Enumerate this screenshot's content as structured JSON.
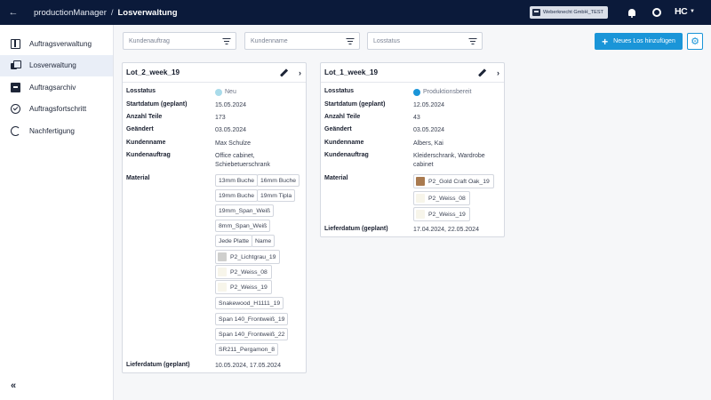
{
  "header": {
    "app_name": "productionManager",
    "separator": "/",
    "page_title": "Losverwaltung",
    "company": "Weberknecht GmbH_TEST",
    "logo": "HC"
  },
  "sidebar": {
    "items": [
      {
        "label": "Auftragsverwaltung",
        "icon": "book-icon"
      },
      {
        "label": "Losverwaltung",
        "icon": "lots-icon",
        "active": true
      },
      {
        "label": "Auftragsarchiv",
        "icon": "archive-icon"
      },
      {
        "label": "Auftragsfortschritt",
        "icon": "progress-icon"
      },
      {
        "label": "Nachfertigung",
        "icon": "rework-icon"
      }
    ],
    "collapse_glyph": "«"
  },
  "filters": {
    "customer_order": "Kundenauftrag",
    "customer_name": "Kundenname",
    "lot_status": "Losstatus"
  },
  "actions": {
    "add_lot": "Neues Los hinzufügen"
  },
  "colors": {
    "header_bg": "#0b1a3a",
    "accent": "#1a95d8",
    "status_new": "#a9dbea",
    "status_production": "#1a95d8"
  },
  "labels": {
    "status": "Losstatus",
    "start": "Startdatum (geplant)",
    "parts": "Anzahl Teile",
    "changed": "Geändert",
    "customer": "Kundenname",
    "order": "Kundenauftrag",
    "material": "Material",
    "delivery": "Lieferdatum (geplant)"
  },
  "cards": [
    {
      "title": "Lot_2_week_19",
      "status": "Neu",
      "status_color": "#a9dbea",
      "start": "15.05.2024",
      "parts": "173",
      "changed": "03.05.2024",
      "customer": "Max Schulze",
      "order_line1": "Office cabinet,",
      "order_line2": "Schiebetuerschrank",
      "materials": [
        {
          "name": "13mm Buche"
        },
        {
          "name": "16mm Buche"
        },
        {
          "name": "19mm Buche"
        },
        {
          "name": "19mm Tipla"
        },
        {
          "name": "19mm_Span_Weiß"
        },
        {
          "name": "8mm_Span_Weiß"
        },
        {
          "name": "Jede Platte"
        },
        {
          "name": "Name"
        },
        {
          "name": "P2_Lichtgrau_19",
          "swatch": "#cfcfcd"
        },
        {
          "name": "P2_Weiss_08",
          "swatch": "#f7f5ea"
        },
        {
          "name": "P2_Weiss_19",
          "swatch": "#f7f5ea"
        },
        {
          "name": "Snakewood_H1111_19"
        },
        {
          "name": "Span 140_Frontweiß_19"
        },
        {
          "name": "Span 140_Frontweiß_22"
        },
        {
          "name": "SR211_Pergamon_8"
        }
      ],
      "delivery": "10.05.2024, 17.05.2024"
    },
    {
      "title": "Lot_1_week_19",
      "status": "Produktionsbereit",
      "status_color": "#1a95d8",
      "start": "12.05.2024",
      "parts": "43",
      "changed": "03.05.2024",
      "customer": "Albers, Kai",
      "order_line1": "Kleiderschrank, Wardrobe",
      "order_line2": "cabinet",
      "materials": [
        {
          "name": "P2_Gold Craft Oak_19",
          "swatch": "#a97a4f"
        },
        {
          "name": "P2_Weiss_08",
          "swatch": "#f7f5ea"
        },
        {
          "name": "P2_Weiss_19",
          "swatch": "#f7f5ea"
        }
      ],
      "delivery": "17.04.2024, 22.05.2024"
    }
  ]
}
